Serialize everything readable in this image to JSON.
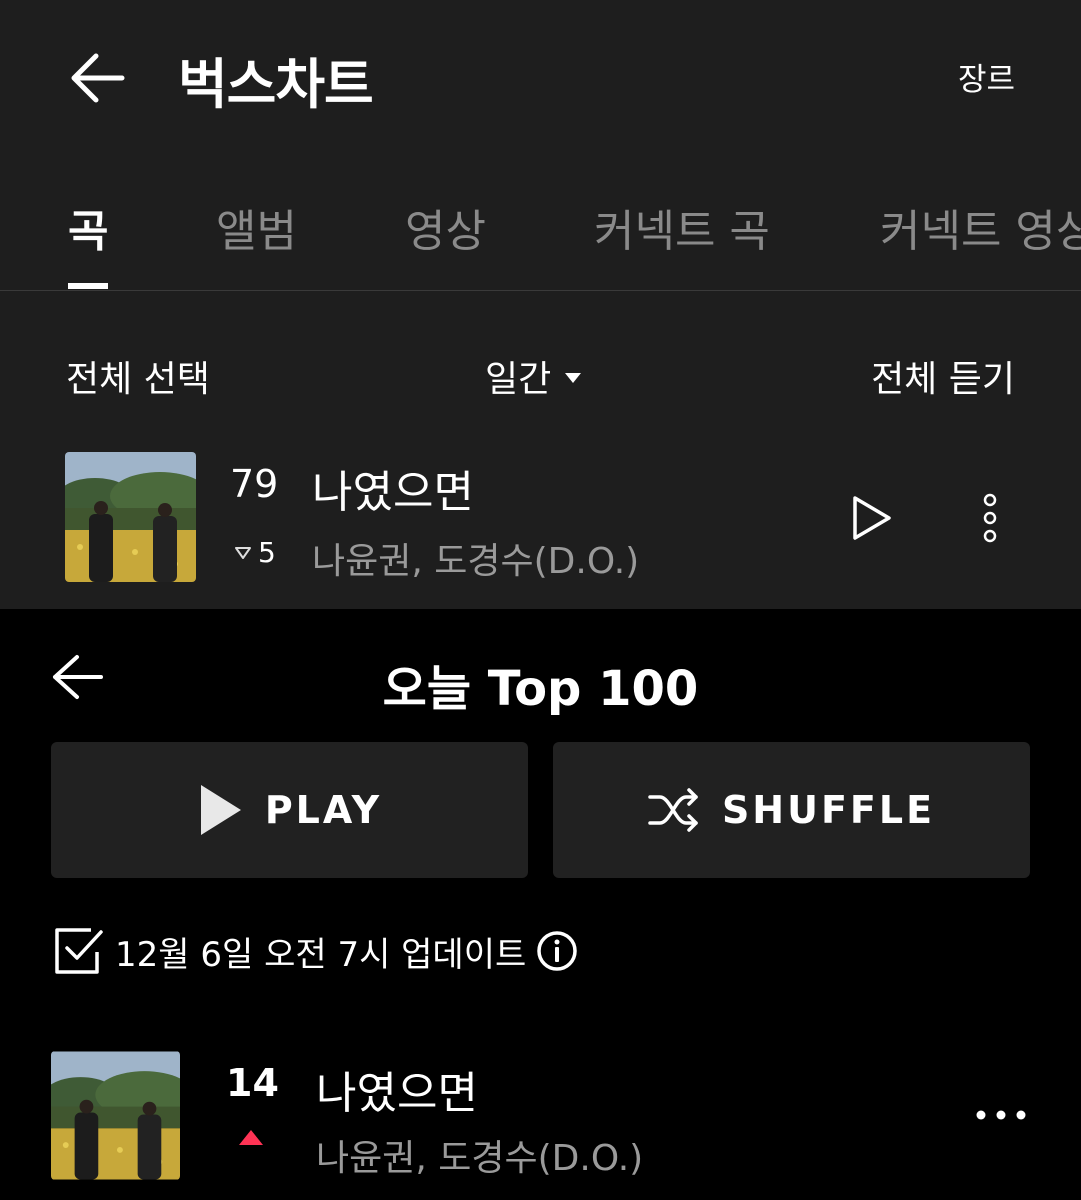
{
  "bugs": {
    "title": "벅스차트",
    "genre_label": "장르",
    "tabs": [
      {
        "label": "곡",
        "active": true
      },
      {
        "label": "앨범",
        "active": false
      },
      {
        "label": "영상",
        "active": false
      },
      {
        "label": "커넥트 곡",
        "active": false
      },
      {
        "label": "커넥트 영상",
        "active": false
      }
    ],
    "select_all": "전체 선택",
    "period": "일간",
    "play_all": "전체 듣기",
    "track": {
      "rank": "79",
      "change": "5",
      "change_direction": "down",
      "title": "나였으면",
      "artist": "나윤권, 도경수(D.O.)"
    }
  },
  "ytm": {
    "title": "오늘 Top 100",
    "play_label": "PLAY",
    "shuffle_label": "SHUFFLE",
    "update_text": "12월 6일 오전 7시 업데이트",
    "track": {
      "rank": "14",
      "change_direction": "up",
      "title": "나였으면",
      "artist": "나윤권, 도경수(D.O.)"
    }
  },
  "colors": {
    "top_panel_bg": "#1e1e1e",
    "bottom_panel_bg": "#000000",
    "button_bg": "#212121",
    "muted_text": "#9a9a9a",
    "up_arrow": "#ff3355"
  },
  "icons": [
    "back-arrow-icon",
    "caret-down-icon",
    "play-icon",
    "more-vertical-icon",
    "shuffle-icon",
    "checkbox-icon",
    "info-icon",
    "more-horizontal-icon"
  ]
}
